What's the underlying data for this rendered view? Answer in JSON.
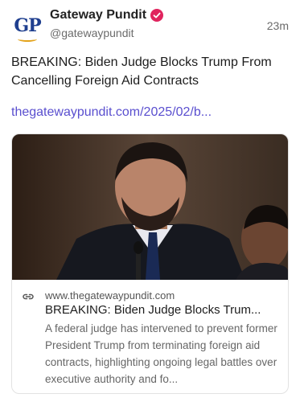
{
  "post": {
    "author": {
      "display_name": "Gateway Pundit",
      "handle": "@gatewaypundit",
      "avatar_text": "GP",
      "verified": true
    },
    "time_ago": "23m",
    "text": "BREAKING: Biden Judge Blocks Trump From Cancelling Foreign Aid Contracts",
    "link_text": "thegatewaypundit.com/2025/02/b...",
    "colors": {
      "link": "#5a4fcf",
      "verified_badge": "#e0245e",
      "avatar_text": "#1f3f8f",
      "avatar_swoosh": "#e3a21a"
    }
  },
  "card": {
    "icon": "link-icon",
    "domain": "www.thegatewaypundit.com",
    "title": "BREAKING: Biden Judge Blocks Trum...",
    "description": "A federal judge has intervened to prevent former President Trump from terminating foreign aid contracts, highlighting ongoing legal battles over executive authority and fo..."
  }
}
